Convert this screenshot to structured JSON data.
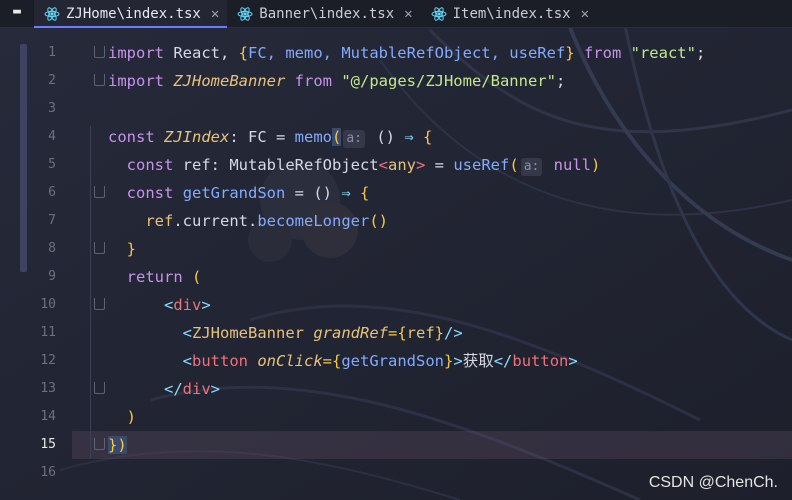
{
  "tabs": [
    {
      "label": "ZJHome\\index.tsx",
      "active": true
    },
    {
      "label": "Banner\\index.tsx",
      "active": false
    },
    {
      "label": "Item\\index.tsx",
      "active": false
    }
  ],
  "line_numbers": [
    "1",
    "2",
    "3",
    "4",
    "5",
    "6",
    "7",
    "8",
    "9",
    "10",
    "11",
    "12",
    "13",
    "14",
    "15",
    "16"
  ],
  "current_line": "15",
  "code": {
    "l1": {
      "a": "import",
      "b": " React, ",
      "c": "{",
      "d": "FC, memo, MutableRefObject, useRef",
      "e": "}",
      "f": " from ",
      "g": "\"react\"",
      "h": ";"
    },
    "l2": {
      "a": "import",
      "b": " ",
      "c": "ZJHomeBanner",
      "d": " from ",
      "e": "\"@/pages/ZJHome/Banner\"",
      "f": ";"
    },
    "l4": {
      "a": "const",
      "b": " ",
      "c": "ZJIndex",
      "d": ": FC = ",
      "e": "memo",
      "f": "(",
      "g": "a:",
      "h": " () ",
      "i": "⇒",
      "j": " {"
    },
    "l5": {
      "a": "const",
      "b": " ref: MutableRefObject",
      "c": "<",
      "d": "any",
      "e": ">",
      "f": " = ",
      "g": "useRef",
      "h": "(",
      "i": "a:",
      "j": " null",
      "k": ")"
    },
    "l6": {
      "a": "const",
      "b": " ",
      "c": "getGrandSon",
      "d": " = () ",
      "e": "⇒",
      "f": " {"
    },
    "l7": {
      "a": "ref",
      "b": ".current.",
      "c": "becomeLonger",
      "d": "()"
    },
    "l8": {
      "a": "}"
    },
    "l9": {
      "a": "return",
      "b": " ("
    },
    "l10": {
      "a": "<",
      "b": "div",
      "c": ">"
    },
    "l11": {
      "a": "<",
      "b": "ZJHomeBanner",
      "c": " ",
      "d": "grandRef",
      "e": "={",
      "f": "ref",
      "g": "}",
      "h": "/>"
    },
    "l12": {
      "a": "<",
      "b": "button",
      "c": " ",
      "d": "onClick",
      "e": "={",
      "f": "getGrandSon",
      "g": "}",
      "h": ">",
      "i": "获取",
      "j": "</",
      "k": "button",
      "l": ">"
    },
    "l13": {
      "a": "</",
      "b": "div",
      "c": ">"
    },
    "l14": {
      "a": ")"
    },
    "l15": {
      "a": "})"
    }
  },
  "watermark": "CSDN @ChenCh.",
  "colors": {
    "keyword": "#c792ea",
    "function": "#82aaff",
    "type": "#e8c27a",
    "string": "#c3e88d",
    "tag": "#f07178",
    "accent": "#6b7cff"
  }
}
